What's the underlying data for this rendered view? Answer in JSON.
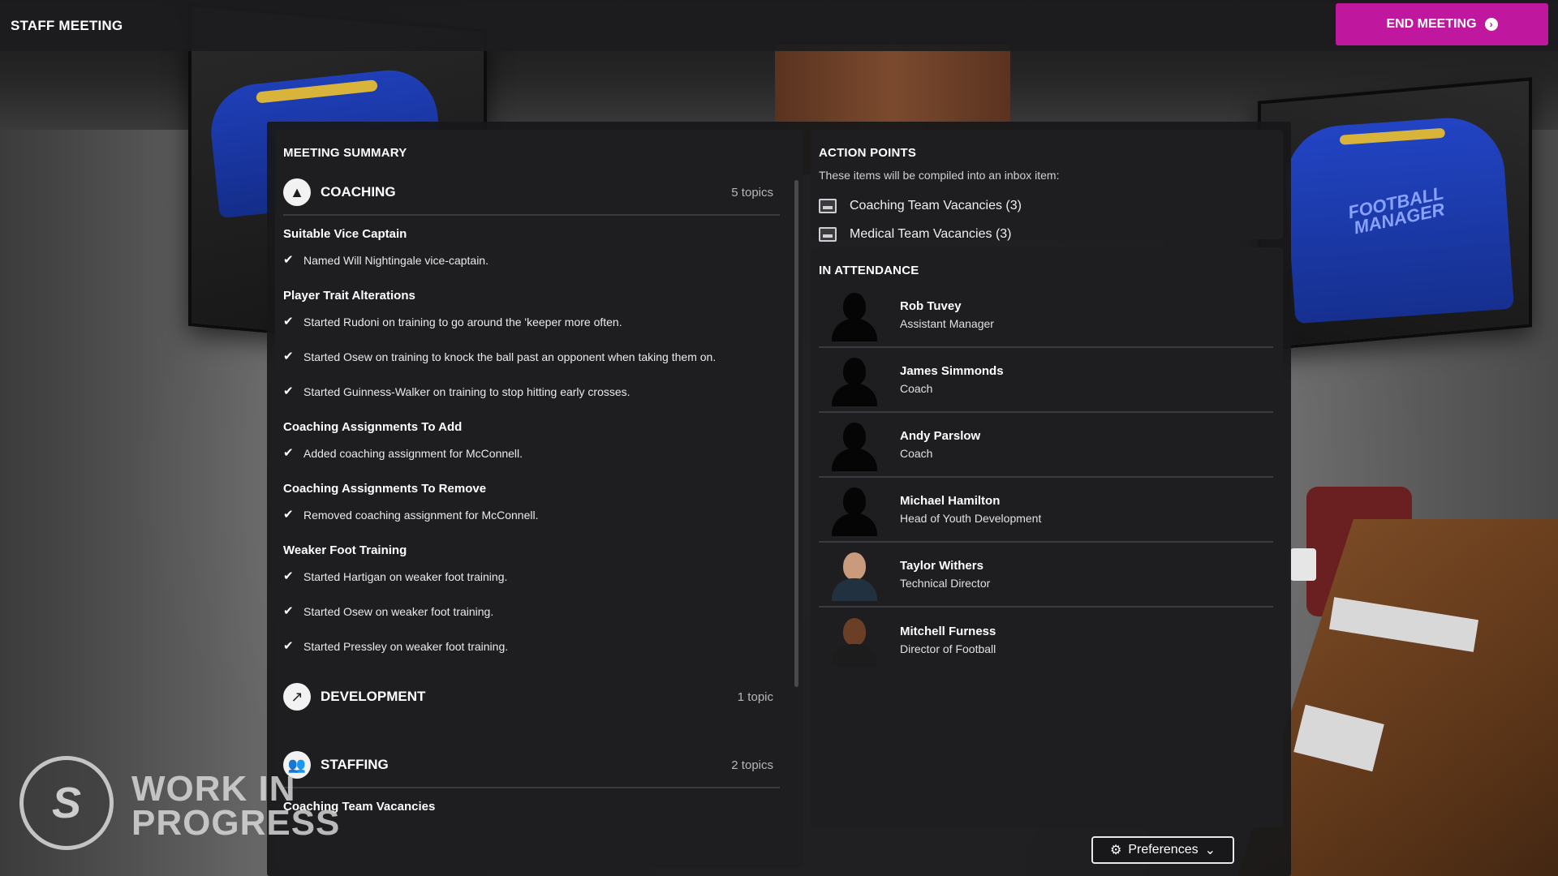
{
  "header": {
    "title": "STAFF MEETING",
    "end_label": "END MEETING"
  },
  "summary": {
    "title": "MEETING SUMMARY",
    "groups": [
      {
        "name": "COACHING",
        "count": "5 topics",
        "icon": "whistle-icon",
        "topics": [
          {
            "title": "Suitable Vice Captain",
            "items": [
              "Named Will Nightingale vice-captain."
            ]
          },
          {
            "title": "Player Trait Alterations",
            "items": [
              "Started Rudoni on training to go around the 'keeper more often.",
              "Started Osew on training to knock the ball past an opponent when taking them on.",
              "Started Guinness-Walker on training to stop hitting early crosses."
            ]
          },
          {
            "title": "Coaching Assignments To Add",
            "items": [
              "Added coaching assignment for McConnell."
            ]
          },
          {
            "title": "Coaching Assignments To Remove",
            "items": [
              "Removed coaching assignment for McConnell."
            ]
          },
          {
            "title": "Weaker Foot Training",
            "items": [
              "Started Hartigan on weaker foot training.",
              "Started Osew on weaker foot training.",
              "Started Pressley on weaker foot training."
            ]
          }
        ]
      },
      {
        "name": "DEVELOPMENT",
        "count": "1 topic",
        "icon": "growth-icon"
      },
      {
        "name": "STAFFING",
        "count": "2 topics",
        "icon": "people-icon",
        "first_topic": "Coaching Team Vacancies"
      }
    ]
  },
  "action_points": {
    "title": "ACTION POINTS",
    "subtitle": "These items will be compiled into an inbox item:",
    "items": [
      "Coaching Team Vacancies (3)",
      "Medical Team Vacancies (3)"
    ]
  },
  "attendance": {
    "title": "IN ATTENDANCE",
    "people": [
      {
        "name": "Rob Tuvey",
        "role": "Assistant Manager"
      },
      {
        "name": "James Simmonds",
        "role": "Coach"
      },
      {
        "name": "Andy Parslow",
        "role": "Coach"
      },
      {
        "name": "Michael Hamilton",
        "role": "Head of Youth Development"
      },
      {
        "name": "Taylor Withers",
        "role": "Technical Director"
      },
      {
        "name": "Mitchell Furness",
        "role": "Director of Football"
      }
    ]
  },
  "preferences_label": "Preferences",
  "watermark": {
    "line1": "WORK IN",
    "line2": "PROGRESS"
  },
  "scene": {
    "shirt_brand": "FOOTBALL MANAGER"
  },
  "colors": {
    "accent": "#c0179f",
    "panel": "#1e1e21"
  }
}
